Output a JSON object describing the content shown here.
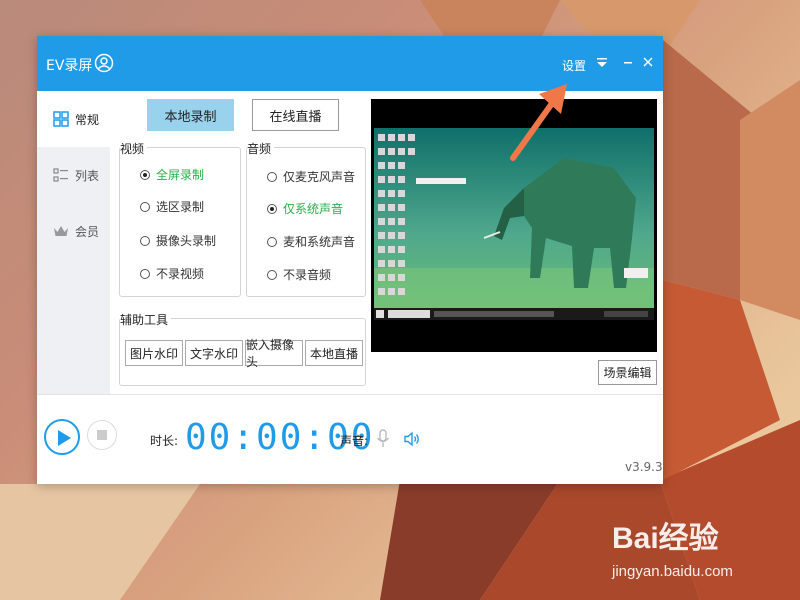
{
  "window": {
    "title": "EV录屏",
    "settings_label": "设置",
    "version": "v3.9.3"
  },
  "sidebar": {
    "items": [
      {
        "label": "常规",
        "icon": "grid-icon",
        "active": true
      },
      {
        "label": "列表",
        "icon": "list-icon",
        "active": false
      },
      {
        "label": "会员",
        "icon": "crown-icon",
        "active": false
      }
    ]
  },
  "mode_tabs": [
    {
      "label": "本地录制",
      "active": true
    },
    {
      "label": "在线直播",
      "active": false
    }
  ],
  "video": {
    "legend": "视频",
    "options": [
      {
        "label": "全屏录制",
        "checked": true
      },
      {
        "label": "选区录制",
        "checked": false
      },
      {
        "label": "摄像头录制",
        "checked": false
      },
      {
        "label": "不录视频",
        "checked": false
      }
    ]
  },
  "audio": {
    "legend": "音频",
    "options": [
      {
        "label": "仅麦克风声音",
        "checked": false
      },
      {
        "label": "仅系统声音",
        "checked": true
      },
      {
        "label": "麦和系统声音",
        "checked": false
      },
      {
        "label": "不录音频",
        "checked": false
      }
    ]
  },
  "tools": {
    "legend": "辅助工具",
    "buttons": [
      "图片水印",
      "文字水印",
      "嵌入摄像头",
      "本地直播"
    ]
  },
  "preview": {
    "scene_button": "场景编辑"
  },
  "recorder": {
    "duration_label": "时长:",
    "timer": "00:00:00",
    "volume_label": "声音:"
  },
  "colors": {
    "accent": "#1f9be8",
    "selected_text": "#27b04a",
    "annotation": "#f07848"
  },
  "watermark": {
    "brand": "Bai经验",
    "url": "jingyan.baidu.com"
  }
}
